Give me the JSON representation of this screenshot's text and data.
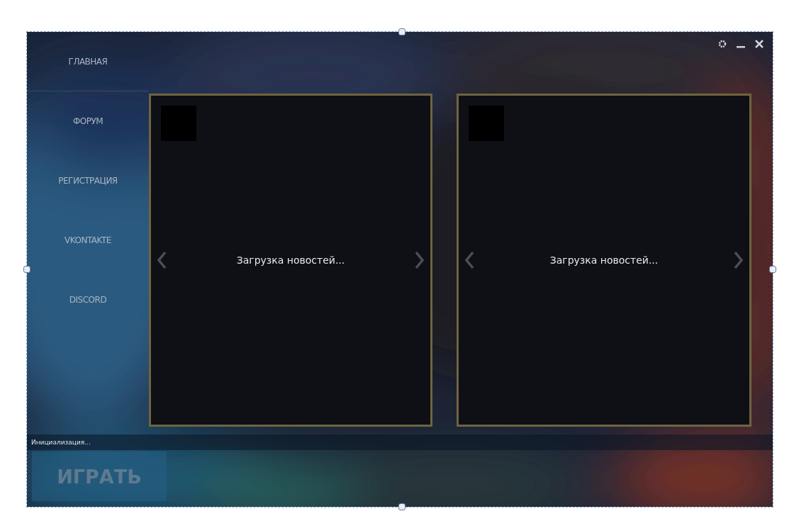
{
  "nav": [
    {
      "label": "ГЛАВНАЯ"
    },
    {
      "label": "ФОРУМ"
    },
    {
      "label": "РЕГИСТРАЦИЯ"
    },
    {
      "label": "VKONTAKTE"
    },
    {
      "label": "DISCORD"
    }
  ],
  "news_panels": [
    {
      "text": "Загрузка новостей..."
    },
    {
      "text": "Загрузка новостей..."
    }
  ],
  "status": "Инициализация...",
  "play_button": "ИГРАТЬ"
}
